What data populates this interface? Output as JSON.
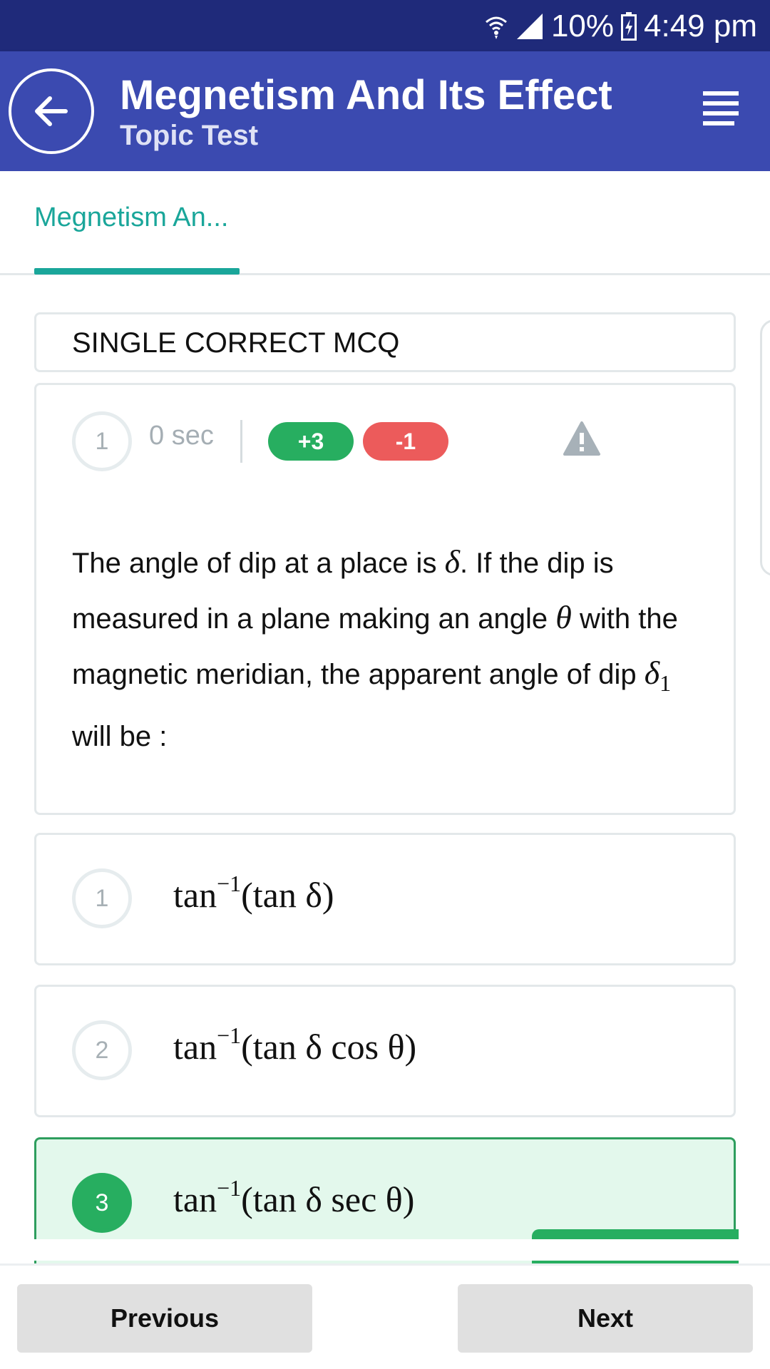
{
  "status_bar": {
    "battery": "10%",
    "time": "4:49 pm"
  },
  "header": {
    "title": "Megnetism And Its Effect",
    "subtitle": "Topic Test"
  },
  "tabs": [
    {
      "label": "Megnetism An...",
      "selected": true
    }
  ],
  "section": {
    "label": "SINGLE CORRECT MCQ"
  },
  "question": {
    "number": "1",
    "time": "0 sec",
    "marks_positive": "+3",
    "marks_negative": "-1",
    "text_parts": {
      "p1": "The angle of dip at a place is ",
      "sym_delta": "δ",
      "p2": ". If the dip is measured in a plane making an angle ",
      "sym_theta": "θ",
      "p3": " with the magnetic meridian, the apparent angle of dip ",
      "sym_delta1": "δ",
      "sub_1": "1",
      "p4": " will be :"
    }
  },
  "options": [
    {
      "number": "1",
      "fn": "tan",
      "exp": "−1",
      "arg": "(tan δ)",
      "selected": false
    },
    {
      "number": "2",
      "fn": "tan",
      "exp": "−1",
      "arg": "(tan δ cos θ)",
      "selected": false
    },
    {
      "number": "3",
      "fn": "tan",
      "exp": "−1",
      "arg": "(tan δ sec θ)",
      "selected": true
    }
  ],
  "navigation": {
    "previous": "Previous",
    "next": "Next"
  },
  "colors": {
    "status_bar": "#1f2a7a",
    "app_bar": "#3b4ab0",
    "accent_teal": "#1aa69a",
    "positive_green": "#27ae60",
    "negative_red": "#ec5b5b",
    "selected_option_bg": "#e3f8ec"
  },
  "icons": [
    "wifi-icon",
    "signal-icon",
    "battery-charging-icon",
    "back-arrow-icon",
    "menu-icon",
    "warning-icon"
  ]
}
